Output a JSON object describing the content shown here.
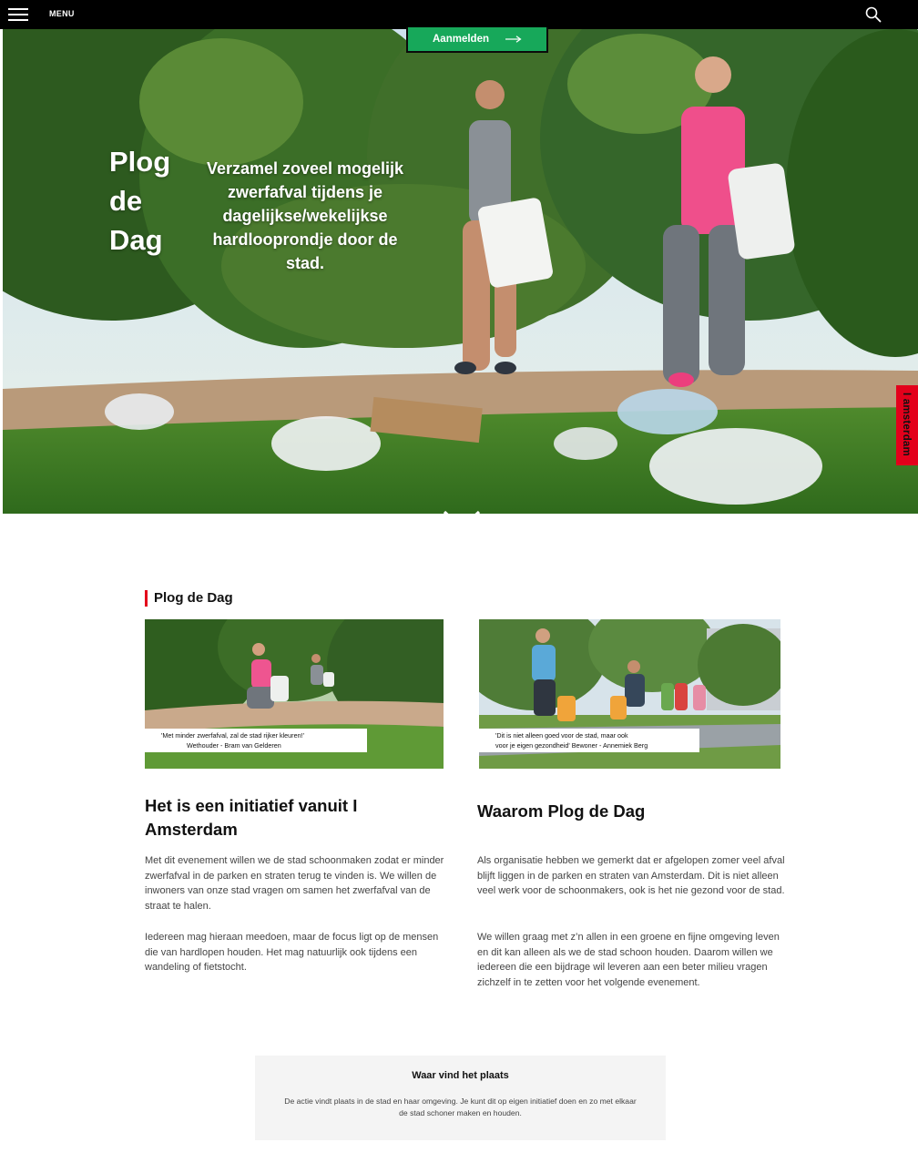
{
  "topbar": {
    "menu_label": "MENU",
    "search_icon": "search-icon",
    "menu_icon": "hamburger-icon"
  },
  "hero": {
    "signup_label": "Aanmelden",
    "title": "Plog de Dag",
    "subtitle": "Verzamel zoveel mogelijk zwerfafval tijdens je dagelijkse/wekelijkse hardlooprondje door de stad.",
    "scroll_icon": "chevron-down-icon",
    "side_tab_label": "I amsterdam"
  },
  "main": {
    "section_heading": "Plog de Dag",
    "photos": [
      {
        "caption_line1": "'Met minder zwerfafval, zal de stad rijker kleuren!'",
        "caption_line2": "Wethouder - Bram van Gelderen"
      },
      {
        "caption_line1": "'Dit is niet alleen goed voor de stad, maar ook",
        "caption_line2": "voor je eigen gezondheid' Bewoner - Annemiek Berg"
      }
    ],
    "columns": [
      {
        "title": "Het is een initiatief vanuit I Amsterdam",
        "paragraph1": "Met dit evenement willen we de stad schoonmaken zodat er minder zwerfafval in de parken en straten terug te vinden is. We willen de inwoners van onze stad vragen om samen het zwerfafval van de straat te halen.",
        "paragraph2": "Iedereen mag hieraan meedoen, maar de focus ligt op de mensen die van hardlopen houden. Het mag natuurlijk ook tijdens een wandeling of fietstocht."
      },
      {
        "title": "Waarom Plog de Dag",
        "paragraph1": "Als organisatie hebben we gemerkt dat er afgelopen zomer veel afval blijft liggen in de parken en straten van Amsterdam. Dit is niet alleen veel werk voor de schoonmakers, ook is het nie gezond voor de stad.",
        "paragraph2": "We willen graag met z’n allen in een groene en fijne omgeving leven en dit kan alleen als we de stad schoon houden. Daarom willen we iedereen die een bijdrage wil leveren aan een beter milieu vragen zichzelf in te zetten voor het volgende evenement."
      }
    ],
    "info_box": {
      "title": "Waar vind het plaats",
      "text": "De actie vindt plaats in de stad en haar omgeving. Je kunt dit op eigen initiatief doen en zo met elkaar de stad schoner maken en houden."
    }
  },
  "colors": {
    "topbar": "#000000",
    "accent_green": "#17a85a",
    "accent_red": "#e3001b",
    "info_bg": "#f4f4f4"
  }
}
